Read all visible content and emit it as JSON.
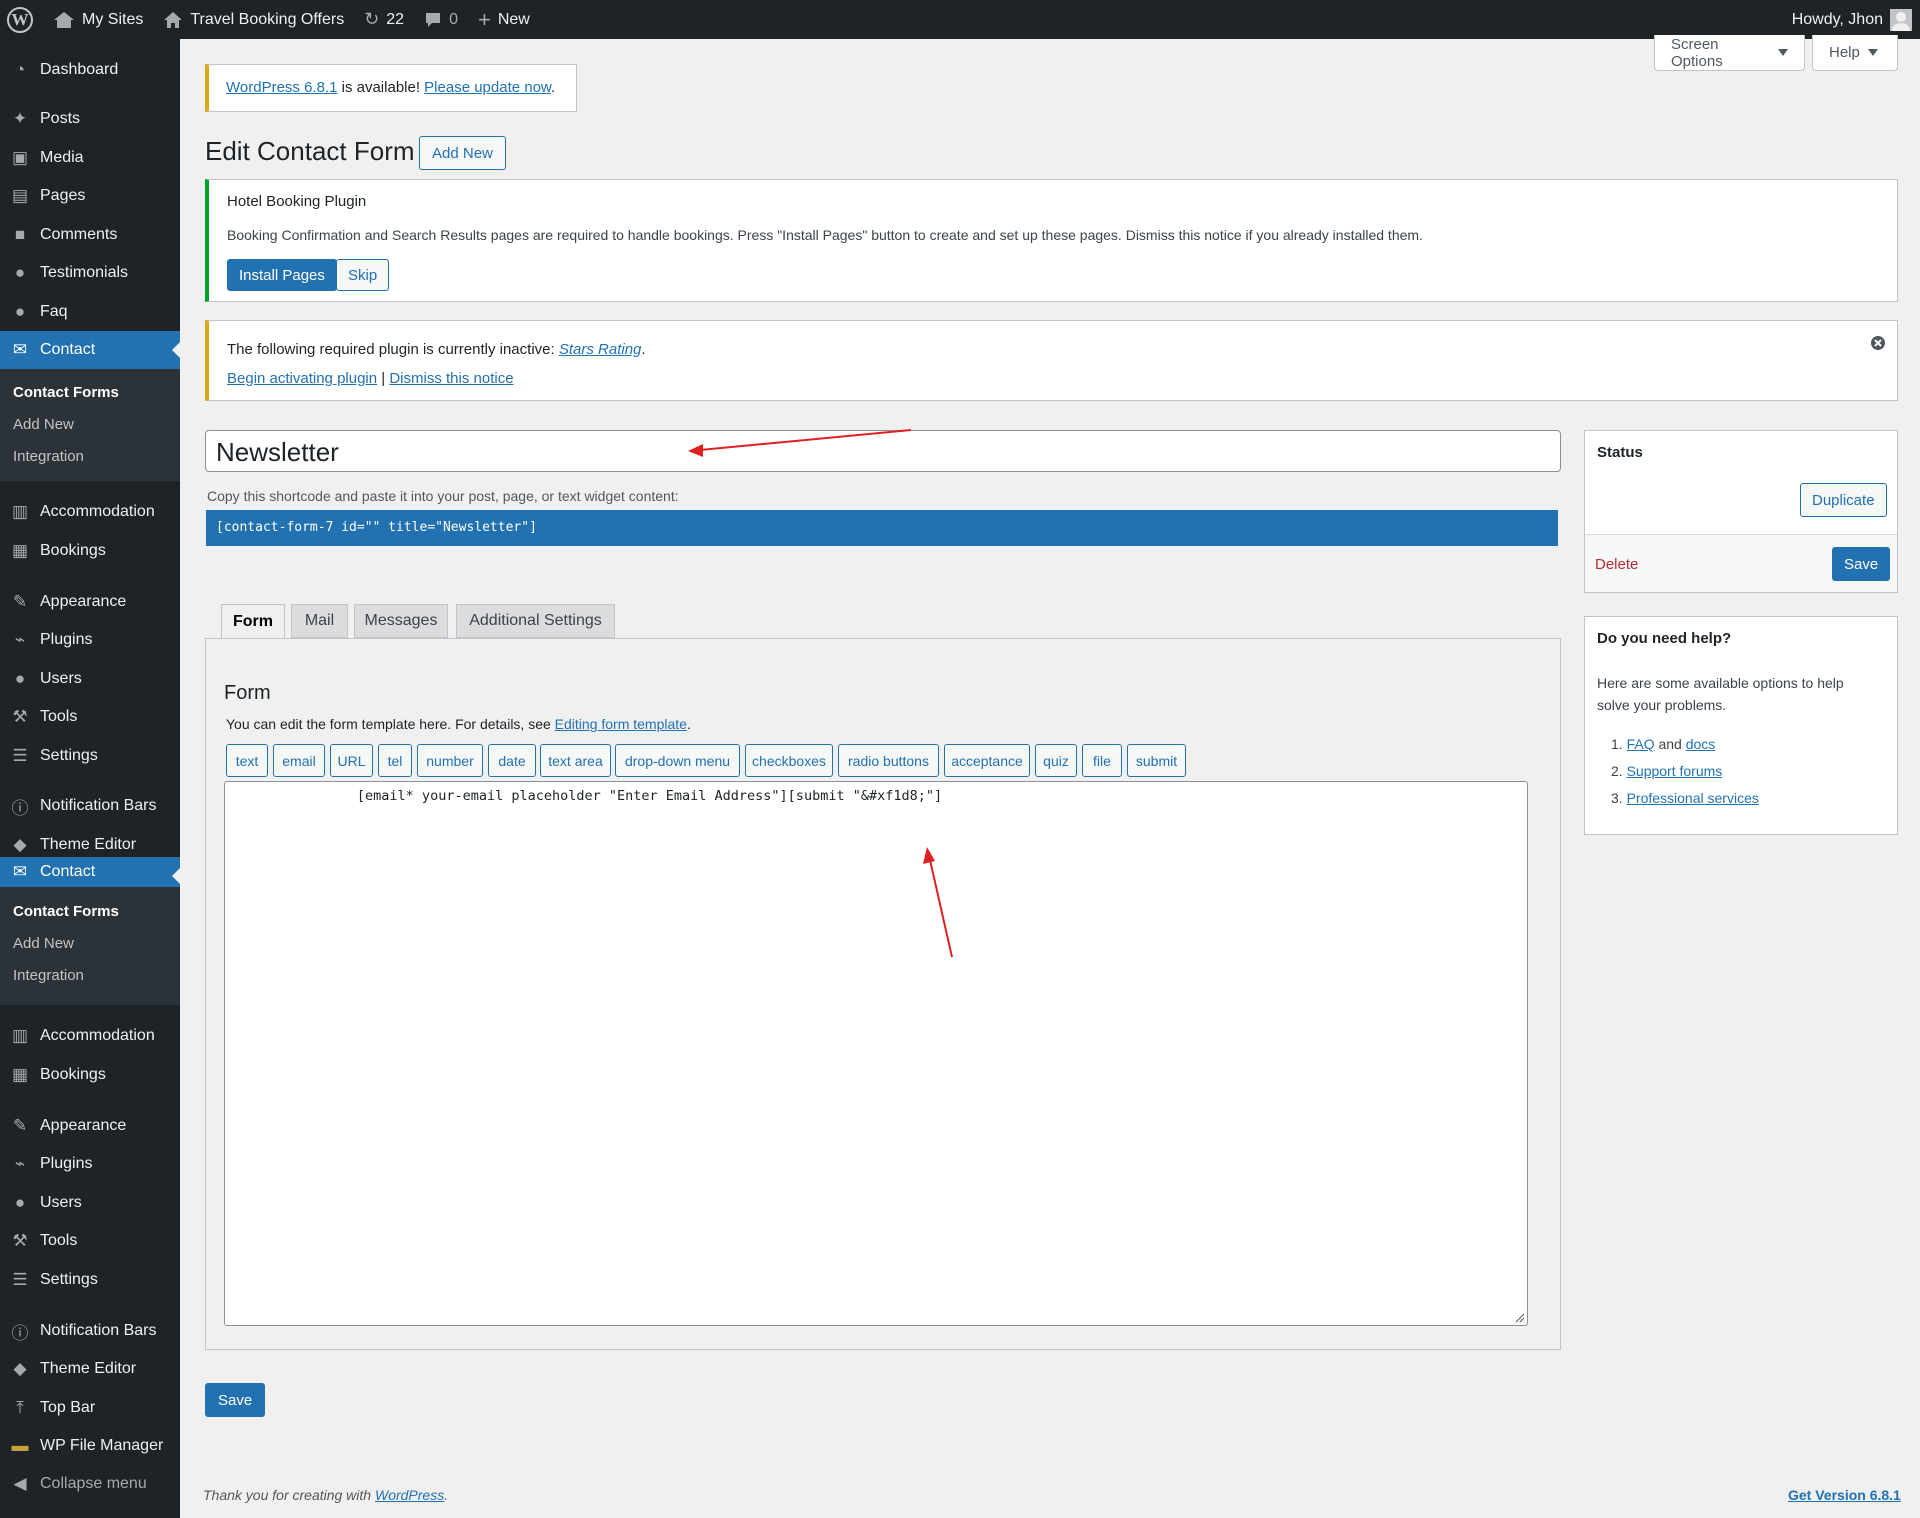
{
  "admin_bar": {
    "my_sites": "My Sites",
    "site_name": "Travel Booking Offers",
    "updates_count": "22",
    "comments_count": "0",
    "new_label": "New",
    "greeting": "Howdy, Jhon"
  },
  "sidebar": {
    "dashboard": "Dashboard",
    "posts": "Posts",
    "media": "Media",
    "pages": "Pages",
    "comments": "Comments",
    "testimonials": "Testimonials",
    "faq": "Faq",
    "contact": "Contact",
    "contact_forms": "Contact Forms",
    "add_new": "Add New",
    "integration": "Integration",
    "accommodation": "Accommodation",
    "bookings": "Bookings",
    "appearance": "Appearance",
    "plugins": "Plugins",
    "users": "Users",
    "tools": "Tools",
    "settings": "Settings",
    "notification_bars": "Notification Bars",
    "theme_editor": "Theme Editor",
    "top_bar": "Top Bar",
    "wp_file_manager": "WP File Manager",
    "collapse_menu": "Collapse menu"
  },
  "screen_options": "Screen Options",
  "help": "Help",
  "update_notice": {
    "link": "WordPress 6.8.1",
    "text": " is available! ",
    "update_link": "Please update now",
    "end": "."
  },
  "page_title": "Edit Contact Form",
  "add_new_button": "Add New",
  "hotel_notice": {
    "title": "Hotel Booking Plugin",
    "text": "Booking Confirmation and Search Results pages are required to handle bookings. Press \"Install Pages\" button to create and set up these pages. Dismiss this notice if you already installed them.",
    "install_button": "Install Pages",
    "skip_button": "Skip"
  },
  "plugin_notice": {
    "text": "The following required plugin is currently inactive: ",
    "plugin_link": "Stars Rating",
    "period": ".",
    "begin_link": "Begin activating plugin",
    "separator": " | ",
    "dismiss_link": "Dismiss this notice"
  },
  "form_title_value": "Newsletter",
  "shortcode_label": "Copy this shortcode and paste it into your post, page, or text widget content:",
  "shortcode": "[contact-form-7 id=\"\" title=\"Newsletter\"]",
  "tabs": [
    "Form",
    "Mail",
    "Messages",
    "Additional Settings"
  ],
  "form_panel": {
    "heading": "Form",
    "desc": "You can edit the form template here. For details, see ",
    "desc_link": "Editing form template",
    "desc_end": ".",
    "tags": [
      "text",
      "email",
      "URL",
      "tel",
      "number",
      "date",
      "text area",
      "drop-down menu",
      "checkboxes",
      "radio buttons",
      "acceptance",
      "quiz",
      "file",
      "submit"
    ],
    "template": "               [email* your-email placeholder \"Enter Email Address\"][submit \"&#xf1d8;\"]"
  },
  "save_button": "Save",
  "status_box": {
    "title": "Status",
    "duplicate": "Duplicate",
    "delete": "Delete",
    "save": "Save"
  },
  "help_box": {
    "title": "Do you need help?",
    "text": "Here are some available options to help solve your problems.",
    "faq": "FAQ",
    "and": " and ",
    "docs": "docs",
    "support": "Support forums",
    "professional": "Professional services"
  },
  "footer": {
    "thanks": "Thank you for creating with ",
    "wp_link": "WordPress",
    "end": ".",
    "version": "Get Version 6.8.1"
  },
  "colors": {
    "admin_dark": "#1d2327",
    "accent_blue": "#2271b1",
    "annotation_red": "#e02020",
    "delete_red": "#b32d2e"
  }
}
